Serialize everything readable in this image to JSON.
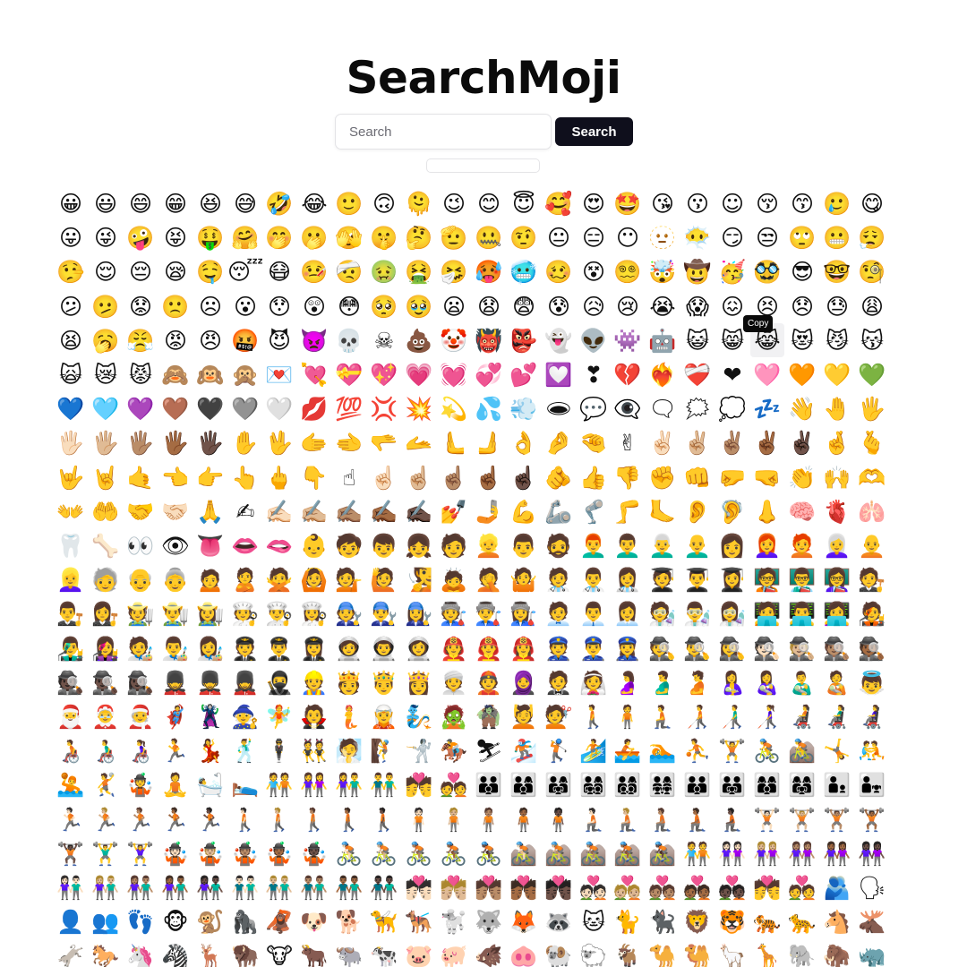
{
  "app": {
    "title": "SearchMoji"
  },
  "search": {
    "placeholder": "Search",
    "value": "",
    "button_label": "Search"
  },
  "tooltip": {
    "label": "Copy"
  },
  "emoji_rows": [
    [
      "😀",
      "😃",
      "😄",
      "😁",
      "😆",
      "😅",
      "🤣",
      "😂",
      "🙂",
      "🙃",
      "🫠",
      "😉",
      "😊",
      "😇",
      "🥰",
      "😍",
      "🤩",
      "😘",
      "😗",
      "☺",
      "😚",
      "😙",
      "🥲",
      "😋"
    ],
    [
      "😛",
      "😜",
      "🤪",
      "😝",
      "🤑",
      "🤗",
      "🤭",
      "🫢",
      "🫣",
      "🤫",
      "🤔",
      "🫡",
      "🤐",
      "🤨",
      "😐",
      "😑",
      "😶",
      "🫥",
      "😶‍🌫️",
      "😏",
      "😒",
      "🙄",
      "😬",
      "😮‍💨"
    ],
    [
      "🤥",
      "😌",
      "😔",
      "😪",
      "🤤",
      "😴",
      "😷",
      "🤒",
      "🤕",
      "🤢",
      "🤮",
      "🤧",
      "🥵",
      "🥶",
      "🥴",
      "😵",
      "😵‍💫",
      "🤯",
      "🤠",
      "🥳",
      "🥸",
      "😎",
      "🤓",
      "🧐"
    ],
    [
      "😕",
      "🫤",
      "😟",
      "🙁",
      "☹",
      "😮",
      "😯",
      "😲",
      "😳",
      "🥺",
      "🥹",
      "😦",
      "😧",
      "😨",
      "😰",
      "😥",
      "😢",
      "😭",
      "😱",
      "😖",
      "😣",
      "😞",
      "😓",
      "😩"
    ],
    [
      "😫",
      "🥱",
      "😤",
      "😡",
      "😠",
      "🤬",
      "😈",
      "👿",
      "💀",
      "☠",
      "💩",
      "🤡",
      "👹",
      "👺",
      "👻",
      "👽",
      "👾",
      "🤖",
      "😺",
      "😸",
      "😹",
      "😻",
      "😼",
      "😽"
    ],
    [
      "🙀",
      "😿",
      "😾",
      "🙈",
      "🙉",
      "🙊",
      "💌",
      "💘",
      "💝",
      "💖",
      "💗",
      "💓",
      "💞",
      "💕",
      "💟",
      "❣",
      "💔",
      "❤️‍🔥",
      "❤️‍🩹",
      "❤",
      "🩷",
      "🧡",
      "💛",
      "💚"
    ],
    [
      "💙",
      "🩵",
      "💜",
      "🤎",
      "🖤",
      "🩶",
      "🤍",
      "💋",
      "💯",
      "💢",
      "💥",
      "💫",
      "💦",
      "💨",
      "🕳",
      "💬",
      "👁️‍🗨️",
      "🗨",
      "🗯",
      "💭",
      "💤",
      "👋",
      "🤚",
      "🖐"
    ],
    [
      "🖐🏻",
      "🖐🏼",
      "🖐🏽",
      "🖐🏾",
      "🖐🏿",
      "✋",
      "🖖",
      "🫱",
      "🫲",
      "🫳",
      "🫴",
      "🫷",
      "🫸",
      "👌",
      "🤌",
      "🤏",
      "✌",
      "✌🏻",
      "✌🏼",
      "✌🏽",
      "✌🏾",
      "✌🏿",
      "🤞",
      "🫰"
    ],
    [
      "🤟",
      "🤘",
      "🤙",
      "👈",
      "👉",
      "👆",
      "🖕",
      "👇",
      "☝",
      "☝🏻",
      "☝🏼",
      "☝🏽",
      "☝🏾",
      "☝🏿",
      "🫵",
      "👍",
      "👎",
      "✊",
      "👊",
      "🤛",
      "🤜",
      "👏",
      "🙌",
      "🫶"
    ],
    [
      "👐",
      "🤲",
      "🤝",
      "🤝🏻",
      "🙏",
      "✍",
      "✍🏻",
      "✍🏼",
      "✍🏽",
      "✍🏾",
      "✍🏿",
      "💅",
      "🤳",
      "💪",
      "🦾",
      "🦿",
      "🦵",
      "🦶",
      "👂",
      "🦻",
      "👃",
      "🧠",
      "🫀",
      "🫁"
    ],
    [
      "🦷",
      "🦴",
      "👀",
      "👁",
      "👅",
      "👄",
      "🫦",
      "👶",
      "🧒",
      "👦",
      "👧",
      "🧑",
      "👱",
      "👨",
      "🧔",
      "👨‍🦰",
      "👨‍🦱",
      "👨‍🦳",
      "👨‍🦲",
      "👩",
      "👩‍🦰",
      "🧑‍🦰",
      "👩‍🦳",
      "🧑‍🦲"
    ],
    [
      "👱‍♀️",
      "🧓",
      "👴",
      "👵",
      "🙍",
      "🙎",
      "🙅",
      "🙆",
      "💁",
      "🙋",
      "🧏",
      "🙇",
      "🤦",
      "🤷",
      "🧑‍⚕️",
      "👨‍⚕️",
      "👩‍⚕️",
      "🧑‍🎓",
      "👨‍🎓",
      "👩‍🎓",
      "🧑‍🏫",
      "👨‍🏫",
      "👩‍🏫",
      "🧑‍⚖️"
    ],
    [
      "👨‍⚖️",
      "👩‍⚖️",
      "🧑‍🌾",
      "👨‍🌾",
      "👩‍🌾",
      "🧑‍🍳",
      "👨‍🍳",
      "👩‍🍳",
      "🧑‍🔧",
      "👨‍🔧",
      "👩‍🔧",
      "🧑‍🏭",
      "👨‍🏭",
      "👩‍🏭",
      "🧑‍💼",
      "👨‍💼",
      "👩‍💼",
      "🧑‍🔬",
      "👨‍🔬",
      "👩‍🔬",
      "🧑‍💻",
      "👨‍💻",
      "👩‍💻",
      "🧑‍🎤"
    ],
    [
      "👨‍🎤",
      "👩‍🎤",
      "🧑‍🎨",
      "👨‍🎨",
      "👩‍🎨",
      "🧑‍✈️",
      "👨‍✈️",
      "👩‍✈️",
      "🧑‍🚀",
      "👨‍🚀",
      "👩‍🚀",
      "🧑‍🚒",
      "👨‍🚒",
      "👩‍🚒",
      "👮",
      "👮‍♂️",
      "👮‍♀️",
      "🕵",
      "🕵️‍♂️",
      "🕵️‍♀️",
      "🕵🏻",
      "🕵🏼",
      "🕵🏽",
      "🕵🏾"
    ],
    [
      "🕵🏿",
      "🕵🏿‍♂️",
      "🕵🏿‍♀️",
      "💂",
      "💂‍♂️",
      "💂‍♀️",
      "🥷",
      "👷",
      "🫅",
      "🤴",
      "👸",
      "👳",
      "👲",
      "🧕",
      "🤵",
      "👰",
      "🤰",
      "🫃",
      "🫄",
      "🤱",
      "👩‍🍼",
      "👨‍🍼",
      "🧑‍🍼",
      "👼"
    ],
    [
      "🎅",
      "🤶",
      "🧑‍🎄",
      "🦸",
      "🦹",
      "🧙",
      "🧚",
      "🧛",
      "🧜",
      "🧝",
      "🧞",
      "🧟",
      "🧌",
      "💆",
      "💇",
      "🚶",
      "🧍",
      "🧎",
      "🧑‍🦯",
      "👨‍🦯",
      "👩‍🦯",
      "🧑‍🦼",
      "👨‍🦼",
      "👩‍🦼"
    ],
    [
      "🧑‍🦽",
      "👨‍🦽",
      "👩‍🦽",
      "🏃",
      "💃",
      "🕺",
      "🕴",
      "👯",
      "🧖",
      "🧗",
      "🤺",
      "🏇",
      "⛷",
      "🏂",
      "🏌",
      "🏄",
      "🚣",
      "🏊",
      "⛹",
      "🏋",
      "🚴",
      "🚵",
      "🤸",
      "🤼"
    ],
    [
      "🤽",
      "🤾",
      "🤹",
      "🧘",
      "🛀",
      "🛌",
      "🧑‍🤝‍🧑",
      "👭",
      "👫",
      "👬",
      "💏",
      "💑",
      "👪",
      "👨‍👩‍👦",
      "👨‍👩‍👧",
      "👨‍👩‍👧‍👦",
      "👨‍👩‍👦‍👦",
      "👨‍👩‍👧‍👧",
      "👨‍👨‍👦",
      "👨‍👨‍👧",
      "👩‍👩‍👦",
      "👩‍👩‍👧",
      "👨‍👦",
      "👨‍👧"
    ],
    [
      "🏃🏻",
      "🏃🏼",
      "🏃🏽",
      "🏃🏾",
      "🏃🏿",
      "🚶🏻",
      "🚶🏼",
      "🚶🏽",
      "🚶🏾",
      "🚶🏿",
      "🧍🏻",
      "🧍🏼",
      "🧍🏽",
      "🧍🏾",
      "🧍🏿",
      "🧎🏻",
      "🧎🏼",
      "🧎🏽",
      "🧎🏾",
      "🧎🏿",
      "🏋🏻",
      "🏋🏼",
      "🏋🏽",
      "🏋🏾"
    ],
    [
      "🏋🏿",
      "🏋️‍♂️",
      "🏋️‍♀️",
      "🤹🏻",
      "🤹🏼",
      "🤹🏽",
      "🤹🏾",
      "🤹🏿",
      "🚴🏻",
      "🚴🏼",
      "🚴🏽",
      "🚴🏾",
      "🚴🏿",
      "🚵🏻",
      "🚵🏼",
      "🚵🏽",
      "🚵🏾",
      "🚵🏿",
      "🧑‍🤝‍🧑",
      "👭🏻",
      "👭🏼",
      "👭🏽",
      "👭🏾",
      "👭🏿"
    ],
    [
      "👫🏻",
      "👫🏼",
      "👫🏽",
      "👫🏾",
      "👫🏿",
      "👬🏻",
      "👬🏼",
      "👬🏽",
      "👬🏾",
      "👬🏿",
      "💏🏻",
      "💏🏼",
      "💏🏽",
      "💏🏾",
      "💏🏿",
      "💑🏻",
      "💑🏼",
      "💑🏽",
      "💑🏾",
      "💑🏿",
      "💏",
      "💑",
      "🫂",
      "🗣"
    ],
    [
      "👤",
      "👥",
      "👣",
      "🐵",
      "🐒",
      "🦍",
      "🦧",
      "🐶",
      "🐕",
      "🦮",
      "🐕‍🦺",
      "🐩",
      "🐺",
      "🦊",
      "🦝",
      "🐱",
      "🐈",
      "🐈‍⬛",
      "🦁",
      "🐯",
      "🐅",
      "🐆",
      "🐴",
      "🫎"
    ],
    [
      "🫏",
      "🐎",
      "🦄",
      "🦓",
      "🦌",
      "🦬",
      "🐮",
      "🐂",
      "🐃",
      "🐄",
      "🐷",
      "🐖",
      "🐗",
      "🐽",
      "🐏",
      "🐑",
      "🐐",
      "🐪",
      "🐫",
      "🦙",
      "🦒",
      "🐘",
      "🦣",
      "🦏"
    ]
  ]
}
